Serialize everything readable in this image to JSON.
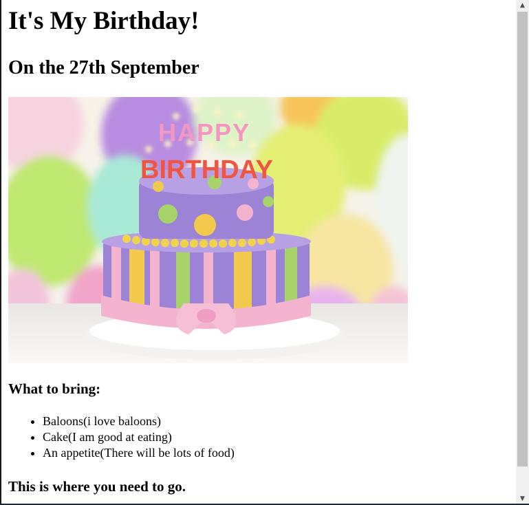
{
  "page": {
    "title": "It's My Birthday!",
    "subtitle": "On the 27th September",
    "image_text_top": "HAPPY",
    "image_text_bottom": "BIRTHDAY",
    "bring_heading": "What to bring:",
    "bring_items": [
      {
        "label": "Baloons(i love baloons)"
      },
      {
        "label": "Cake(I am good at eating)"
      },
      {
        "label": "An appetite(There will be lots of food)"
      }
    ],
    "go_heading": "This is where you need to go."
  },
  "colors": {
    "cake_purple": "#9d83d6",
    "cake_yellow": "#f2c94c",
    "cake_green": "#a6d46a",
    "cake_pink": "#f4b3cf",
    "scrollbar_thumb": "#c1c1c1"
  },
  "icons": {
    "scroll_up": "triangle-up-icon",
    "scroll_down": "triangle-down-icon",
    "bullet": "disc"
  }
}
